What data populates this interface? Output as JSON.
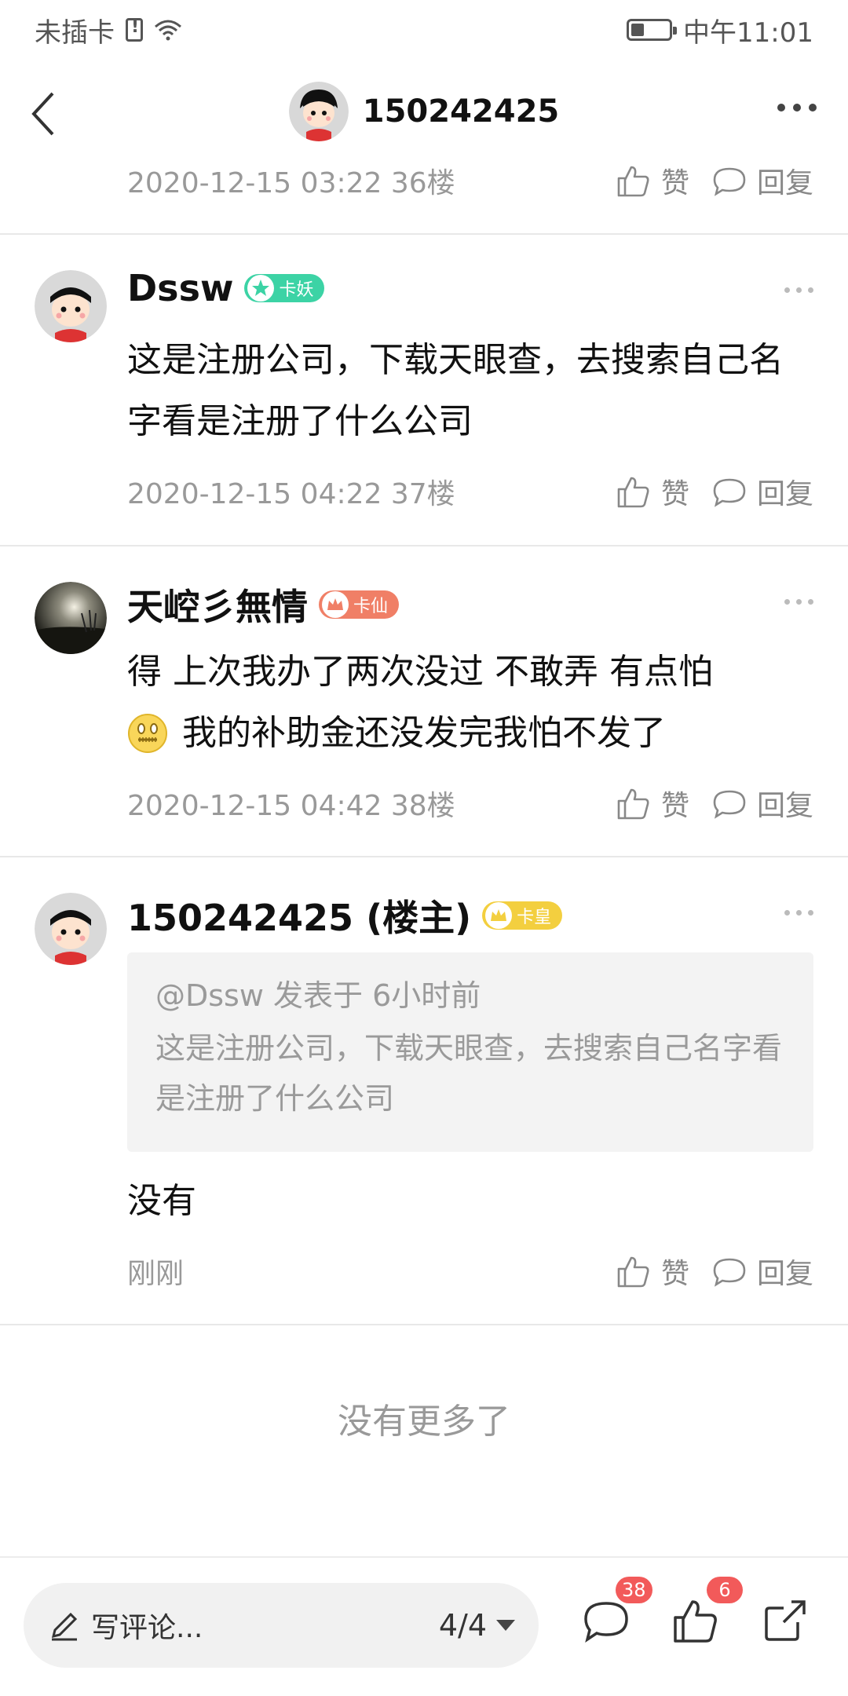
{
  "status_bar": {
    "carrier": "未插卡",
    "time": "中午11:01"
  },
  "header": {
    "title": "150242425"
  },
  "top_post": {
    "meta": "2020-12-15 03:22  36楼",
    "like_label": "赞",
    "reply_label": "回复"
  },
  "posts": [
    {
      "username": "Dssw",
      "badge": "卡妖",
      "badge_color": "#3cd3a5",
      "body": "这是注册公司，下载天眼查，去搜索自己名字看是注册了什么公司",
      "meta": "2020-12-15 04:22  37楼",
      "like_label": "赞",
      "reply_label": "回复"
    },
    {
      "username": "天崆彡無情",
      "badge": "卡仙",
      "badge_color": "#f07f66",
      "body_line1": "得  上次我办了两次没过  不敢弄  有点怕",
      "body_line2": "我的补助金还没发完我怕不发了",
      "emoji": "zipper-mouth-emoji",
      "meta": "2020-12-15 04:42  38楼",
      "like_label": "赞",
      "reply_label": "回复"
    },
    {
      "username": "150242425 (楼主)",
      "badge": "卡皇",
      "badge_color": "#f3cf3f",
      "quote_head": "@Dssw 发表于 6小时前",
      "quote_text": "这是注册公司，下载天眼查，去搜索自己名字看是注册了什么公司",
      "body": "没有",
      "meta": "刚刚",
      "like_label": "赞",
      "reply_label": "回复"
    }
  ],
  "no_more": "没有更多了",
  "bottom_bar": {
    "comment_placeholder": "写评论...",
    "page_indicator": "4/4",
    "comments_count": "38",
    "likes_count": "6"
  },
  "colors": {
    "accent_red": "#f25a5a",
    "meta_gray": "#999999"
  }
}
